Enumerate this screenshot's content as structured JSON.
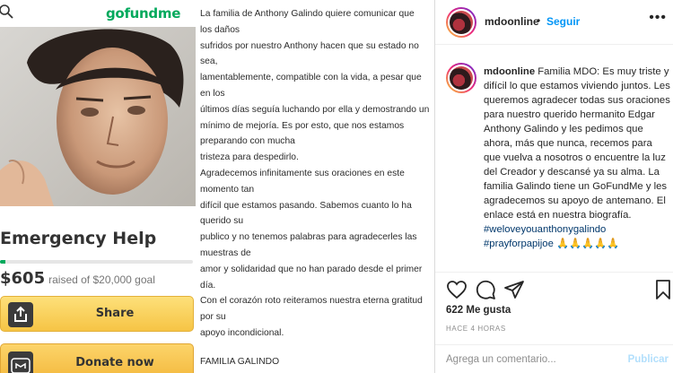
{
  "gofundme": {
    "logo_text": "gofundme",
    "title": "Emergency Help",
    "amount_raised": "$605",
    "goal_text": "raised of $20,000 goal",
    "progress_fraction": 0.03,
    "share_label": "Share",
    "donate_label": "Donate now",
    "donate_icon_text": "go\nfund\nme",
    "colors": {
      "brand_green": "#02a95c",
      "button_yellow": "#f6c445"
    }
  },
  "statement": {
    "lines": [
      "La familia de Anthony Galindo quiere comunicar que",
      "los daños",
      "sufridos por nuestro Anthony hacen que su estado no",
      "sea,",
      "lamentablemente, compatible con la vida, a pesar que",
      "en los",
      "últimos días seguía luchando por ella y demostrando un",
      "mínimo de mejoría.  Es por esto, que nos estamos",
      "preparando con mucha",
      "tristeza para despedirlo.",
      "Agradecemos infinitamente sus oraciones en este",
      "momento tan",
      "difícil que estamos pasando. Sabemos cuanto lo ha",
      "querido su",
      "publico y no tenemos palabras para agradecerles las",
      "muestras de",
      "amor y solidaridad que no han parado desde el primer",
      "día.",
      "Con el corazón roto reiteramos nuestra eterna gratitud",
      "por su",
      "apoyo incondicional.",
      "",
      "FAMILIA GALINDO"
    ]
  },
  "instagram": {
    "username": "mdoonline",
    "separator": "•",
    "follow_label": "Seguir",
    "more_icon": "•••",
    "caption_text": "Familia MDO: Es muy triste y difícil lo que estamos viviendo juntos. Les queremos agradecer todas sus oraciones para nuestro querido hermanito Edgar Anthony Galindo y les pedimos que ahora, más que nunca, recemos para que vuelva a nosotros o encuentre la luz del Creador y descansé ya su alma. La familia Galindo tiene un GoFundMe y les agradecemos su apoyo de antemano. El enlace está en nuestra biografía.",
    "hashtags": [
      "#weloveyouanthonygalindo",
      "#prayforpapijoe"
    ],
    "hashtag_emojis": "🙏🙏🙏🙏🙏",
    "likes": "622 Me gusta",
    "time_ago": "HACE 4 HORAS",
    "comment_placeholder": "Agrega un comentario...",
    "publish_label": "Publicar",
    "icons": [
      "heart-icon",
      "comment-icon",
      "share-icon",
      "bookmark-icon"
    ],
    "colors": {
      "link_blue": "#0095f6",
      "hashtag": "#00376b",
      "muted": "#8e8e8e"
    }
  }
}
